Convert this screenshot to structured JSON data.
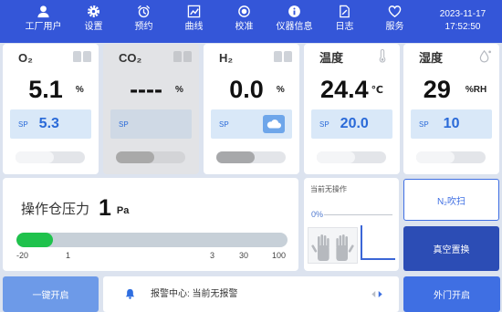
{
  "theme": {
    "nav_bg": "#3456d8",
    "accent": "#2a6ad8",
    "sp_bg": "#d9e8f8",
    "pressure_fill": "#1fc24c",
    "button_blue": "#3f6fe3",
    "button_dark": "#2c4db5",
    "button_light": "#6d9ae8"
  },
  "nav": {
    "items": [
      {
        "label": "工厂用户",
        "icon": "user-icon"
      },
      {
        "label": "设置",
        "icon": "gear-icon"
      },
      {
        "label": "预约",
        "icon": "alarm-clock-icon"
      },
      {
        "label": "曲线",
        "icon": "chart-icon"
      },
      {
        "label": "校准",
        "icon": "calibrate-icon"
      },
      {
        "label": "仪器信息",
        "icon": "info-icon"
      },
      {
        "label": "日志",
        "icon": "log-icon"
      },
      {
        "label": "服务",
        "icon": "service-icon"
      }
    ],
    "date": "2023-11-17",
    "time": "17:52:50"
  },
  "sensors": [
    {
      "label": "O₂",
      "value": "5.1",
      "unit": "%",
      "sp_label": "SP",
      "sp_value": "5.3",
      "icon": "gas-cylinder-icon",
      "disabled": false,
      "knob_color": "#f4f5f7"
    },
    {
      "label": "CO₂",
      "value": "----",
      "unit": "%",
      "sp_label": "SP",
      "sp_value": "",
      "icon": "gas-cylinder-icon",
      "disabled": true,
      "knob_color": "#a9a9a9"
    },
    {
      "label": "H₂",
      "value": "0.0",
      "unit": "%",
      "sp_label": "SP",
      "sp_value": "",
      "icon": "gas-cylinder-icon",
      "sp_icon": "cloud-icon",
      "disabled": false,
      "knob_color": "#a7a8aa"
    },
    {
      "label": "温度",
      "value": "24.4",
      "unit": "℃",
      "sp_label": "SP",
      "sp_value": "20.0",
      "icon": "thermometer-icon",
      "disabled": false,
      "knob_color": "#f4f5f7"
    },
    {
      "label": "湿度",
      "value": "29",
      "unit": "%RH",
      "sp_label": "SP",
      "sp_value": "10",
      "icon": "droplet-icon",
      "disabled": false,
      "knob_color": "#f4f5f7"
    }
  ],
  "pressure": {
    "label": "操作仓压力",
    "value": "1",
    "unit": "Pa",
    "level": 0.135,
    "ticks": [
      "-20",
      "1",
      "3",
      "30",
      "100"
    ]
  },
  "operation": {
    "status": "当前无操作",
    "progress_label": "0%",
    "progress": 0
  },
  "actions": {
    "n2_purge": "N₂吹扫",
    "vacuum_replace": "真空置换"
  },
  "footer": {
    "one_key_open": "一键开启",
    "alarm_text": "报警中心: 当前无报警",
    "outer_door_open": "外门开启"
  }
}
